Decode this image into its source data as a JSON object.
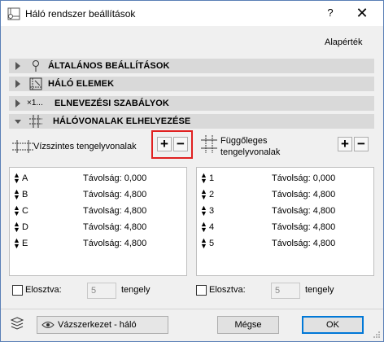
{
  "window": {
    "title": "Háló rendszer beállítások",
    "help_glyph": "?",
    "close_glyph": "✕"
  },
  "defaults_label": "Alapérték",
  "sections": [
    {
      "label": "ÁLTALÁNOS BEÁLLÍTÁSOK",
      "icon": "pin-icon",
      "expanded": false
    },
    {
      "label": "HÁLÓ ELEMEK",
      "icon": "grid-element-icon",
      "expanded": false
    },
    {
      "label": "ELNEVEZÉSI SZABÁLYOK",
      "icon": "naming-icon",
      "icon_text": "×1...",
      "expanded": false
    },
    {
      "label": "HÁLÓVONALAK ELHELYEZÉSE",
      "icon": "grid-lines-icon",
      "expanded": true
    }
  ],
  "horizontal": {
    "label": "Vízszintes tengelyvonalak",
    "add": "+",
    "remove": "−",
    "rows": [
      {
        "name": "A",
        "distance": "Távolság: 0,000"
      },
      {
        "name": "B",
        "distance": "Távolság: 4,800"
      },
      {
        "name": "C",
        "distance": "Távolság: 4,800"
      },
      {
        "name": "D",
        "distance": "Távolság: 4,800"
      },
      {
        "name": "E",
        "distance": "Távolság: 4,800"
      }
    ],
    "distribute_label": "Elosztva:",
    "count_value": "5",
    "count_unit": "tengely"
  },
  "vertical": {
    "label_line1": "Függőleges",
    "label_line2": "tengelyvonalak",
    "add": "+",
    "remove": "−",
    "rows": [
      {
        "name": "1",
        "distance": "Távolság: 0,000"
      },
      {
        "name": "2",
        "distance": "Távolság: 4,800"
      },
      {
        "name": "3",
        "distance": "Távolság: 4,800"
      },
      {
        "name": "4",
        "distance": "Távolság: 4,800"
      },
      {
        "name": "5",
        "distance": "Távolság: 4,800"
      }
    ],
    "distribute_label": "Elosztva:",
    "count_value": "5",
    "count_unit": "tengely"
  },
  "footer": {
    "view_label": "Vázszerkezet - háló",
    "cancel": "Mégse",
    "ok": "OK"
  },
  "colors": {
    "accent": "#0078d7",
    "highlight": "#e02020",
    "section_bg": "#d9d9d9"
  }
}
